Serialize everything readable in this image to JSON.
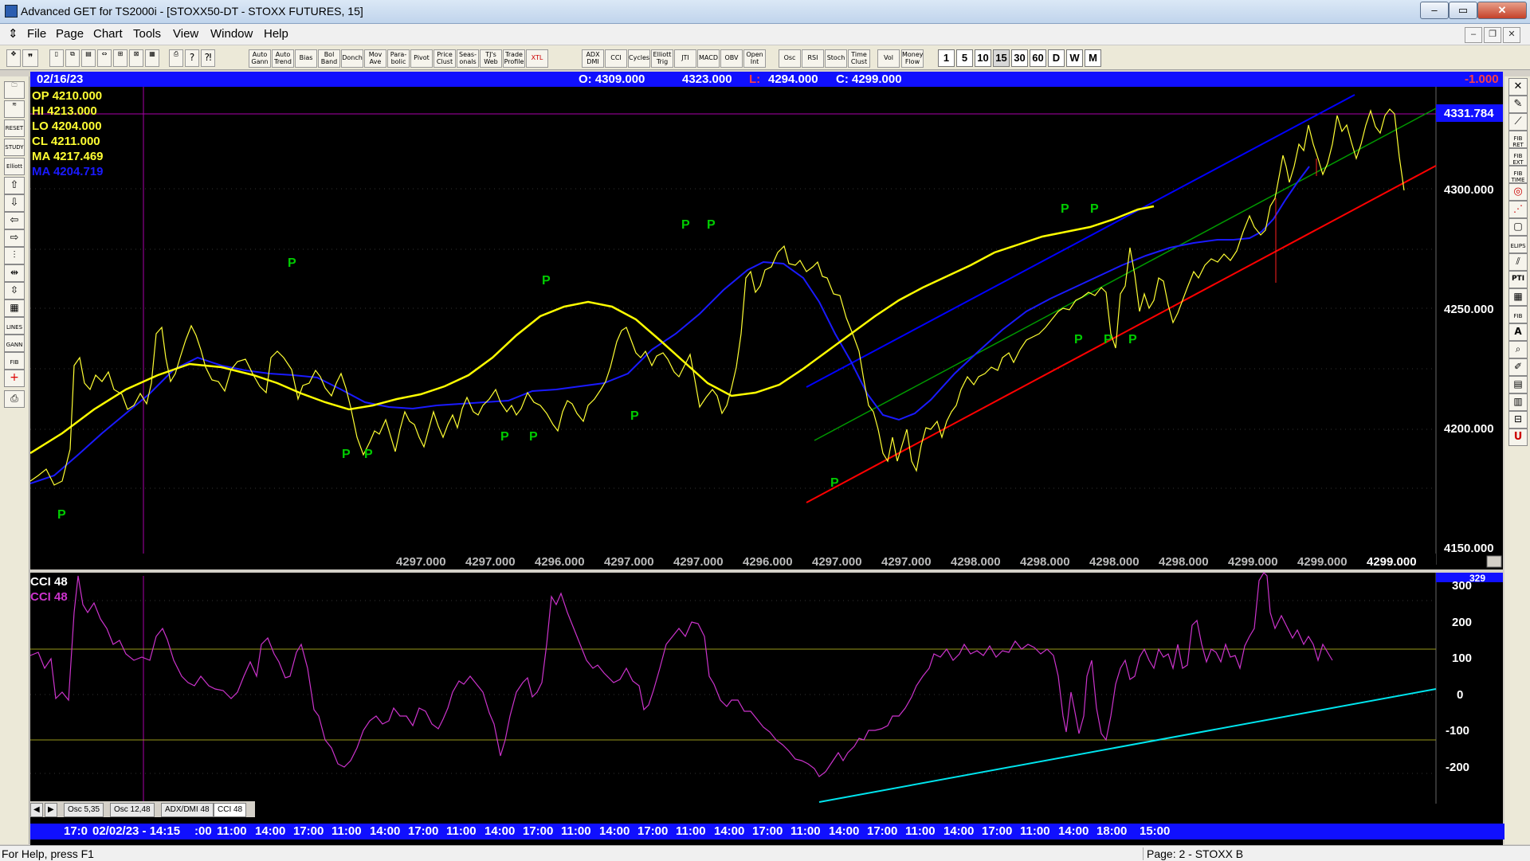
{
  "window": {
    "title": "Advanced GET for TS2000i - [STOXX50-DT - STOXX FUTURES, 15]"
  },
  "menu": [
    "File",
    "Page",
    "Chart",
    "Tools",
    "View",
    "Window",
    "Help"
  ],
  "toolbar_indicators": [
    "Auto Gann",
    "Auto Trend",
    "Bias",
    "Bol Band",
    "Donch",
    "Mov Ave",
    "Para- bolic",
    "Pivot",
    "Price Clust",
    "Seas- onals",
    "TJ's Web",
    "Trade Profile",
    "XTL",
    "ADX DMI",
    "CCI",
    "Cycles",
    "Elliott Trig",
    "JTI",
    "MACD",
    "OBV",
    "Open Int",
    "Osc",
    "RSI",
    "Stoch",
    "Time Clust",
    "Vol",
    "Money Flow"
  ],
  "timeframes": [
    "1",
    "5",
    "10",
    "15",
    "30",
    "60",
    "D",
    "W",
    "M"
  ],
  "active_timeframe": "15",
  "left_tools": [
    "",
    "",
    "RESET",
    "STUDY",
    "Elliott",
    "",
    "",
    "",
    "",
    "",
    "",
    "",
    "",
    "LINES",
    "GANN",
    "FIB",
    "",
    ""
  ],
  "right_tools": [
    "",
    "",
    "",
    "FIB RET",
    "FIB EXT",
    "FIB TIME",
    "",
    "",
    "",
    "ELIPS",
    "",
    "PTI",
    "",
    "FIB",
    "A",
    "",
    "",
    "",
    "",
    "",
    "U"
  ],
  "info": {
    "date": "02/16/23",
    "open": "O: 4309.000",
    "high": "4323.000",
    "low_label": "L:",
    "low": "4294.000",
    "close": "C: 4299.000",
    "change": "-1.000"
  },
  "legend": {
    "op": "OP  4210.000",
    "hi": "HI   4213.000",
    "lo": "LO  4204.000",
    "cl": "CL  4211.000",
    "ma1": "MA  4217.469",
    "ma2": "MA  4204.719"
  },
  "price_axis": {
    "labels": [
      "4300.000",
      "4250.000",
      "4200.000",
      "4150.000"
    ],
    "current": "4331.784"
  },
  "value_row": [
    "4297.000",
    "4297.000",
    "4296.000",
    "4297.000",
    "4297.000",
    "4296.000",
    "4297.000",
    "4297.000",
    "4298.000",
    "4298.000",
    "4298.000",
    "4298.000",
    "4299.000",
    "4299.000"
  ],
  "value_row_last": "4299.000",
  "pivot_label": "P",
  "cci": {
    "title": "CCI 48",
    "title2": "CCI  48",
    "axis": [
      "300",
      "200",
      "100",
      "0",
      "-100",
      "-200"
    ],
    "current": "329"
  },
  "tabs": [
    "Osc 5,35",
    "Osc 12,48",
    "ADX/DMI 48",
    "CCI 48"
  ],
  "time_axis": {
    "cursor_label": "02/02/23 - 14:15",
    "first": "17:0",
    "labels": [
      ":00",
      "11:00",
      "14:00",
      "17:00",
      "11:00",
      "14:00",
      "17:00",
      "11:00",
      "14:00",
      "17:00",
      "11:00",
      "14:00",
      "17:00",
      "11:00",
      "14:00",
      "17:00",
      "11:00",
      "14:00",
      "17:00",
      "11:00",
      "14:00",
      "17:00",
      "11:00",
      "14:00",
      "18:00",
      "15:00"
    ]
  },
  "status": {
    "help": "For Help, press F1",
    "page": "Page: 2 - STOXX B"
  },
  "colors": {
    "price": "#ffff33",
    "ma_yellow": "#ffff00",
    "ma_blue": "#1a1aff",
    "channel_blue": "#0000ff",
    "channel_green": "#009900",
    "channel_red": "#ff0000",
    "cci": "#cc33cc",
    "cci_trend": "#00e5ee",
    "pivot": "#00cc00",
    "cursor": "#aa00aa"
  }
}
